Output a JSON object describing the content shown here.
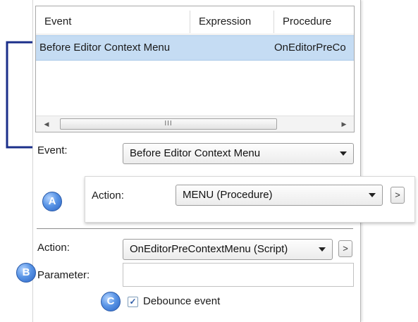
{
  "event_list": {
    "columns": [
      "Event",
      "Expression",
      "Procedure"
    ],
    "rows": [
      {
        "event": "Before Editor Context Menu",
        "expression": "",
        "procedure": "OnEditorPreCo"
      }
    ],
    "scroll_left_icon": "scroll-left-arrow",
    "scroll_right_icon": "scroll-right-arrow",
    "scroll_thumb_grip": "III"
  },
  "event_field": {
    "label": "Event:",
    "value": "Before Editor Context Menu"
  },
  "popup_action": {
    "label": "Action:",
    "value": "MENU (Procedure)",
    "more_label": ">"
  },
  "action_field": {
    "label": "Action:",
    "value": "OnEditorPreContextMenu (Script)",
    "more_label": ">"
  },
  "parameter_field": {
    "label": "Parameter:",
    "value": ""
  },
  "debounce": {
    "label": "Debounce event",
    "checked": true,
    "check_mark": "✓"
  },
  "callouts": {
    "a": "A",
    "b": "B",
    "c": "C"
  },
  "colors": {
    "callout_line": "#1b2f8a",
    "badge": "#3d7ad8",
    "selection": "#c5dcf3"
  }
}
